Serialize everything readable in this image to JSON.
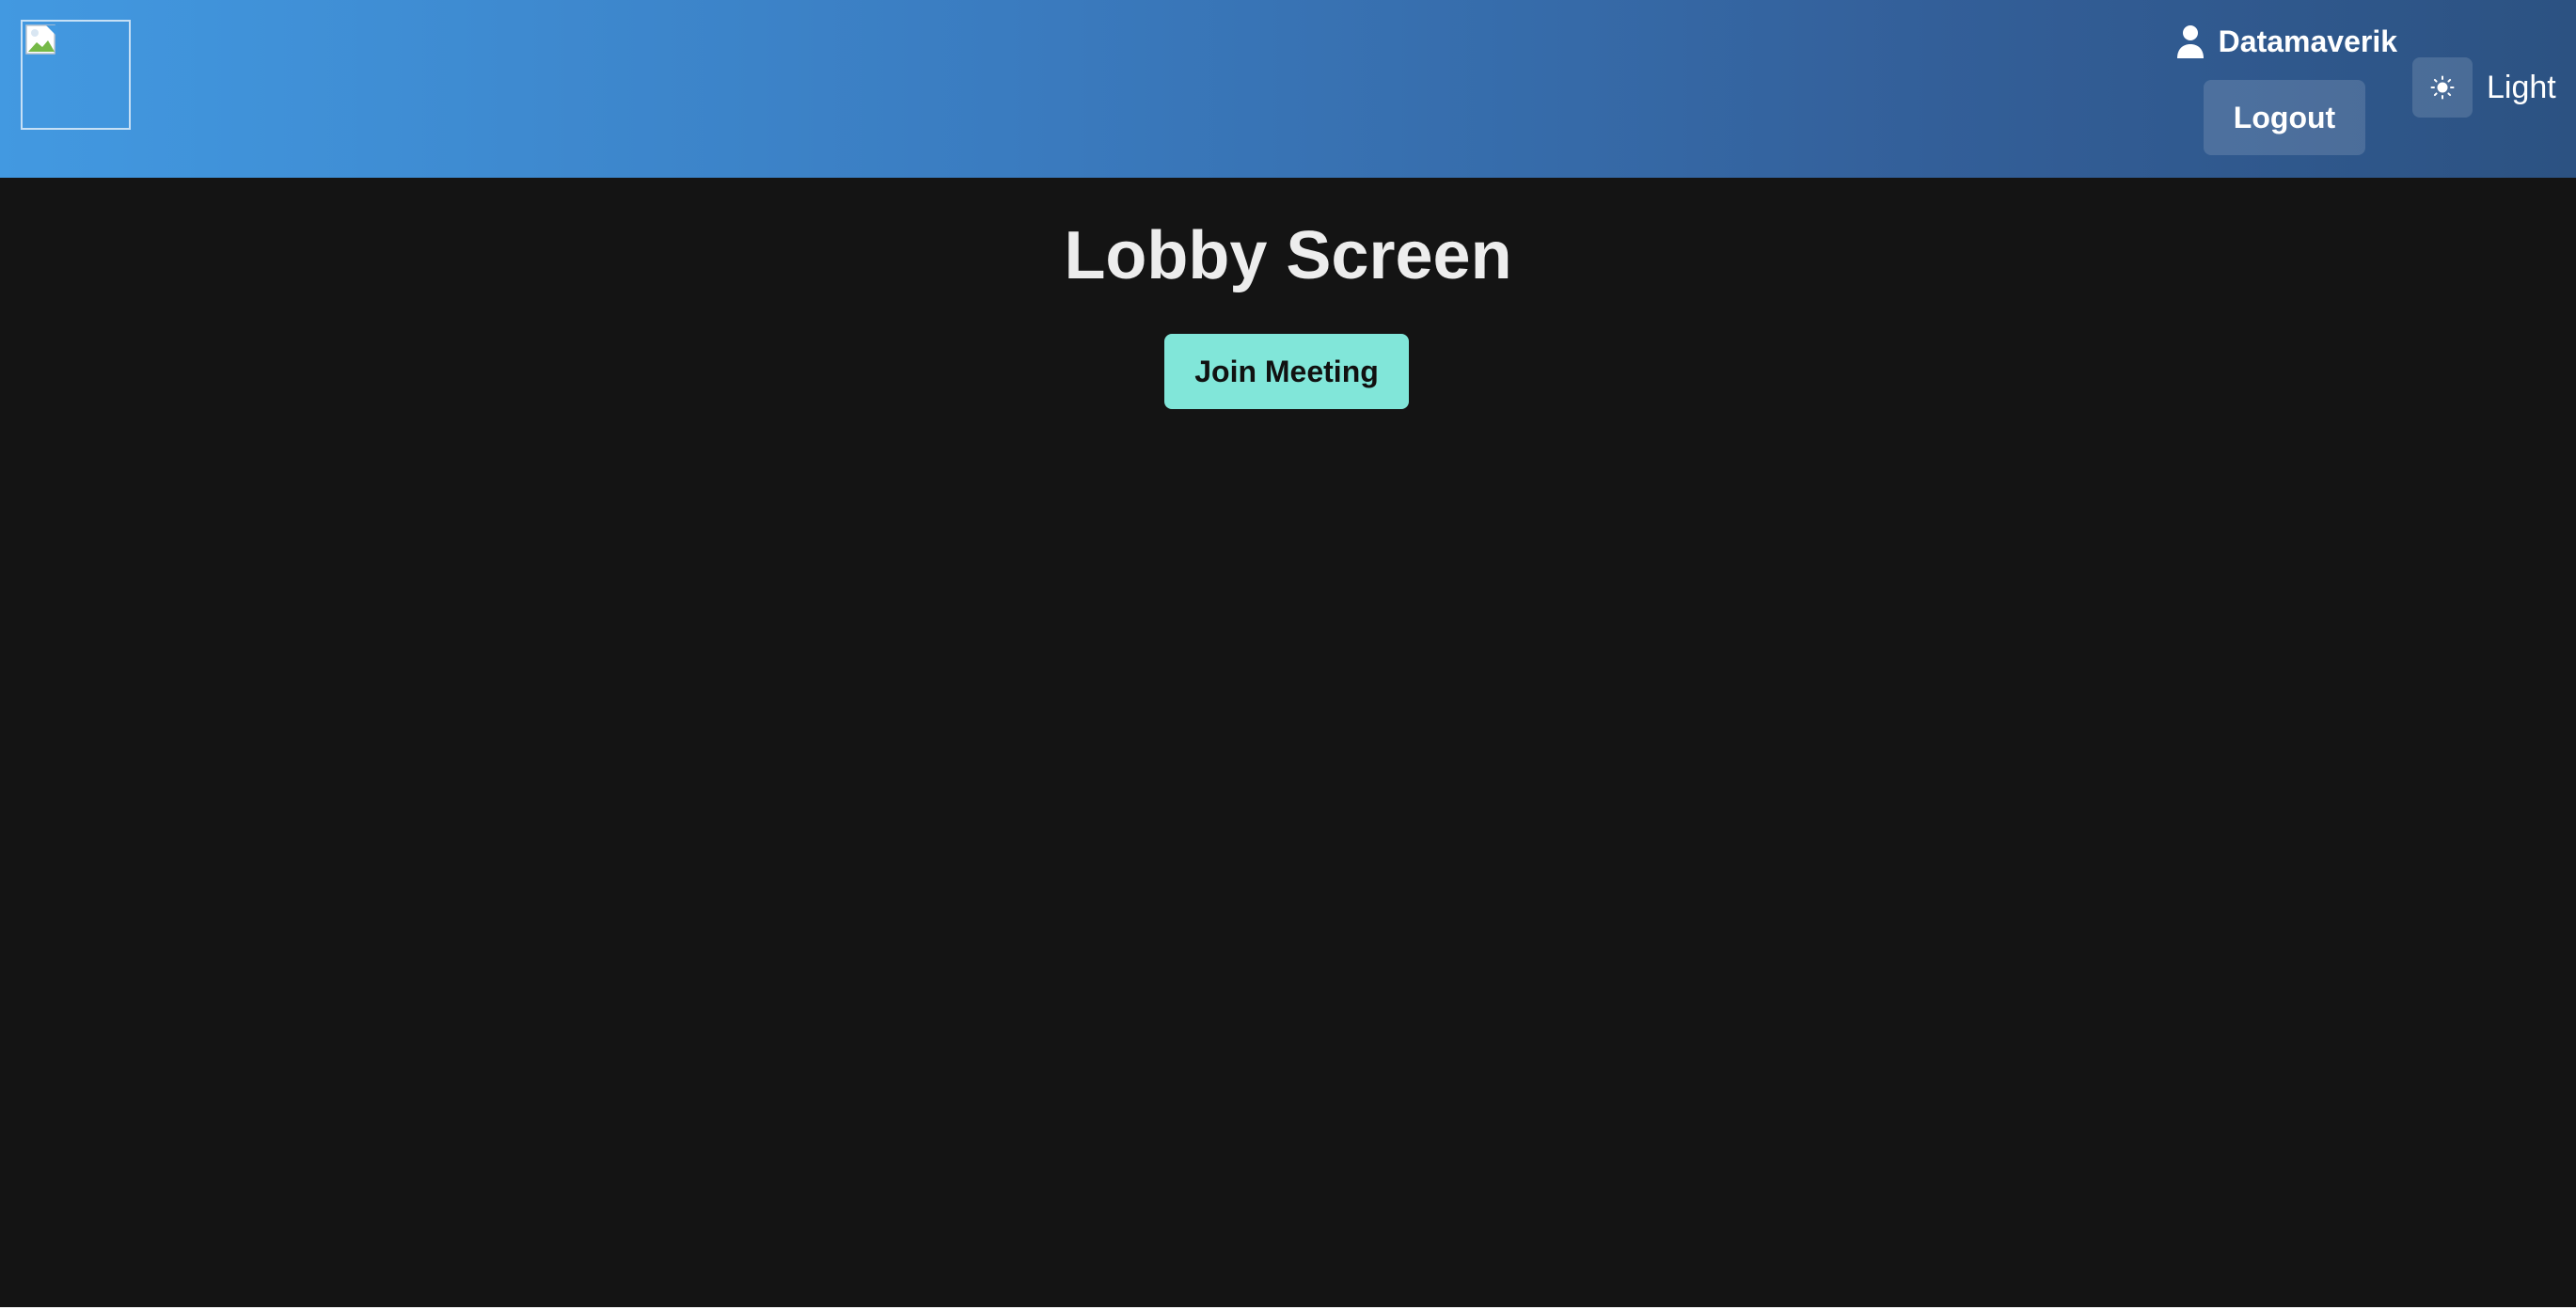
{
  "header": {
    "user": {
      "icon": "user-icon",
      "name": "Datamaverik"
    },
    "logout_label": "Logout",
    "theme_toggle": {
      "icon": "sun-icon",
      "label": "Light"
    },
    "colors": {
      "gradient_start": "#4299e1",
      "gradient_end": "#2c5282"
    }
  },
  "main": {
    "title": "Lobby Screen",
    "join_label": "Join Meeting",
    "colors": {
      "background": "#141414",
      "join_button": "#81e6d9"
    }
  }
}
